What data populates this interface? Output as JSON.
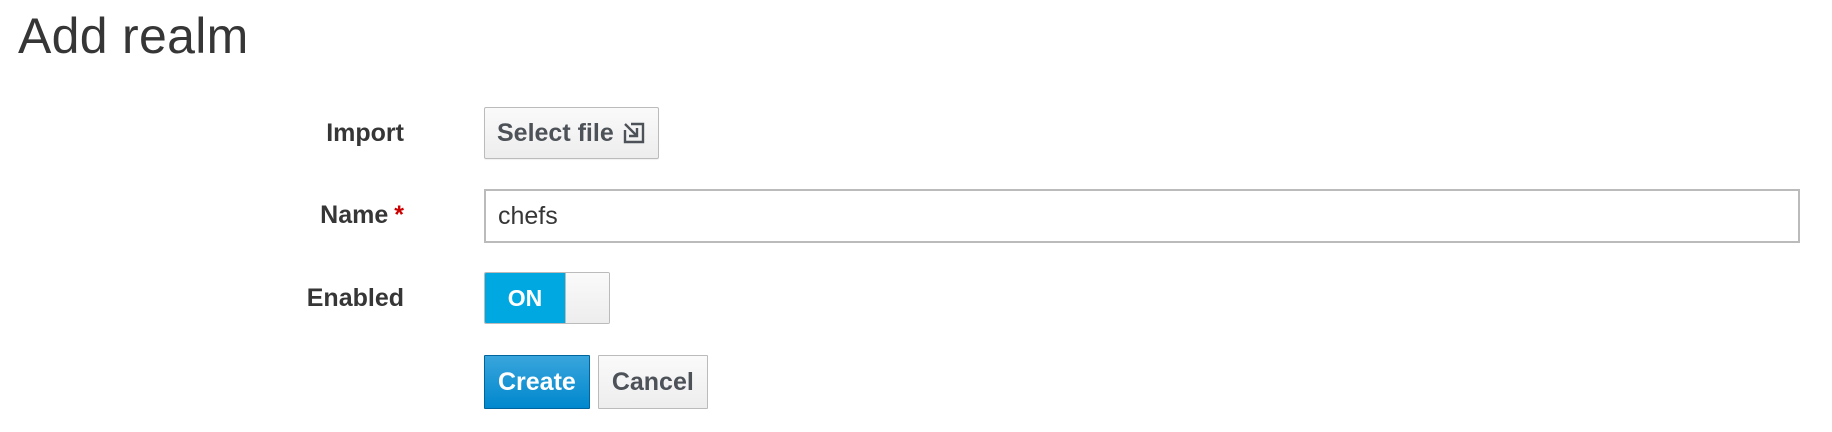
{
  "page": {
    "title": "Add realm"
  },
  "form": {
    "import": {
      "label": "Import",
      "button_label": "Select file",
      "button_icon": "import-icon"
    },
    "name": {
      "label": "Name",
      "required_marker": "*",
      "value": "chefs",
      "placeholder": ""
    },
    "enabled": {
      "label": "Enabled",
      "state_label": "ON",
      "checked": true
    }
  },
  "actions": {
    "create_label": "Create",
    "cancel_label": "Cancel"
  },
  "colors": {
    "primary": "#0088ce",
    "toggle_on": "#00a8e1",
    "required": "#cc0000",
    "text": "#363636"
  }
}
